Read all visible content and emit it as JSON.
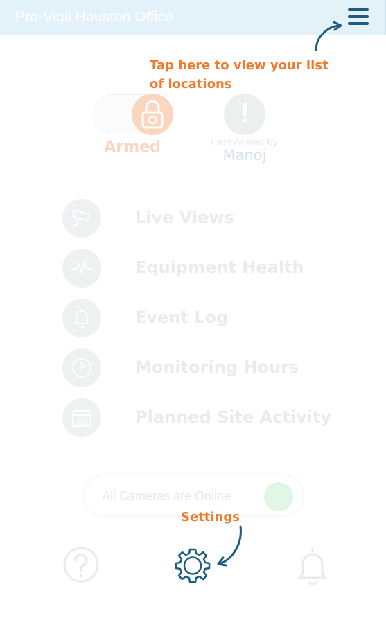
{
  "header": {
    "title": "Pro-Vigil Houston Office",
    "menu_icon": "hamburger-menu-icon"
  },
  "coach_marks": {
    "locations_tip": "Tap here to view your list of locations",
    "settings_tip": "Settings",
    "accent_color": "#f07a2e",
    "arrow_color": "#1d5c7c"
  },
  "arm_status": {
    "state_label": "Armed",
    "lock_icon": "padlock-icon",
    "alert_icon": "exclamation-icon",
    "last_armed_label": "Last Armed by",
    "last_armed_by": "Manoj"
  },
  "menu": {
    "items": [
      {
        "label": "Live Views",
        "icon": "security-camera-icon"
      },
      {
        "label": "Equipment Health",
        "icon": "heartbeat-icon"
      },
      {
        "label": "Event Log",
        "icon": "bell-icon"
      },
      {
        "label": "Monitoring Hours",
        "icon": "clock-icon"
      },
      {
        "label": "Planned Site Activity",
        "icon": "calendar-icon"
      }
    ]
  },
  "camera_status": {
    "text": "All Cameras are Online",
    "indicator_color": "#e2f6e6"
  },
  "bottom_nav": {
    "help_icon": "help-question-icon",
    "settings_icon": "settings-gear-icon",
    "notifications_icon": "notification-bell-icon"
  }
}
